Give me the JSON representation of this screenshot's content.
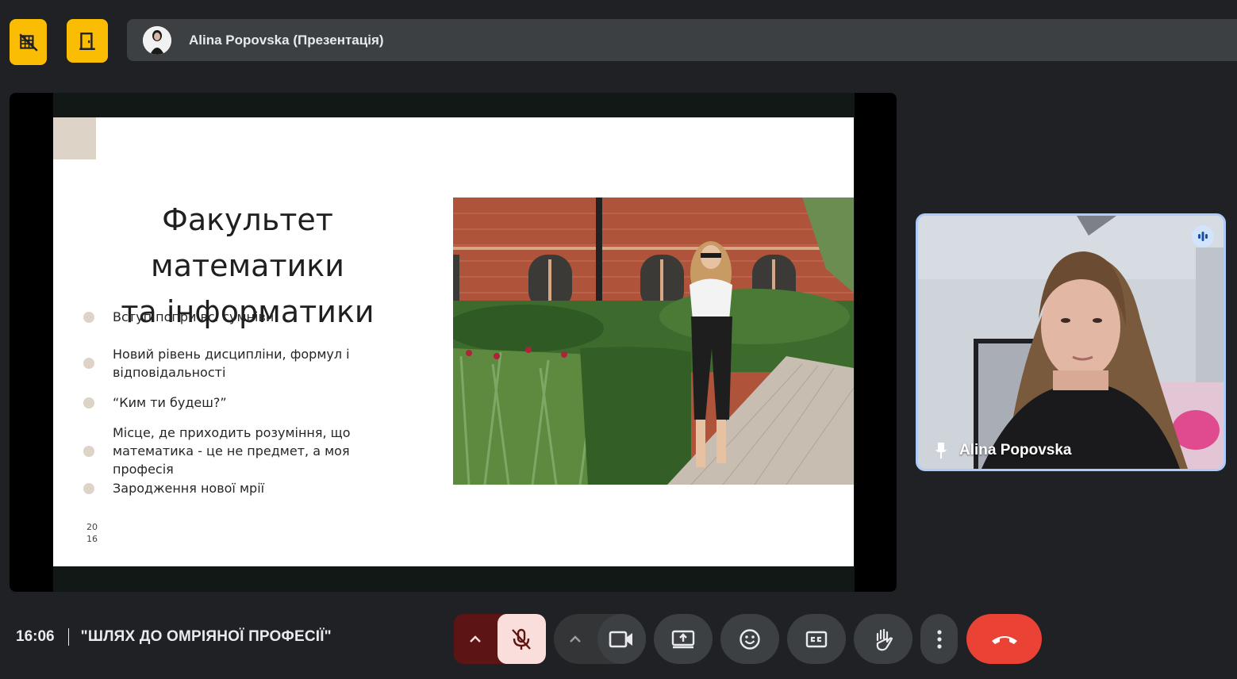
{
  "top_controls": {
    "hide_icon": "videocam-off-grid-icon",
    "room_icon": "door-icon"
  },
  "presenter_bar": {
    "label": "Alina Popovska (Презентація)"
  },
  "slide": {
    "title_line1": "Факультет математики",
    "title_line2": "та інформатики",
    "bullets": [
      "Вступ попри всі сумніви",
      "Новий рівень дисципліни, формул і відповідальності",
      "“Ким ти будеш?”",
      "Місце, де приходить розуміння, що математика - це не предмет, а моя професія",
      "Зародження нової мрії"
    ],
    "year_top": "20",
    "year_bottom": "16",
    "accent_color": "#ddd3c6"
  },
  "self_tile": {
    "name": "Alina Popovska",
    "border_color": "#aecbfa"
  },
  "footer": {
    "time": "16:06",
    "meeting_title": "\"ШЛЯХ ДО ОМРІЯНОЇ ПРОФЕСІЇ\""
  },
  "toolbar": {
    "mic_state": "muted",
    "buttons": [
      "mic-options",
      "mic",
      "camera-options",
      "camera",
      "present",
      "emoji",
      "captions",
      "raise-hand",
      "more-options",
      "leave-call"
    ],
    "hangup_color": "#ea4335",
    "mic_muted_color": "#f9dedc"
  }
}
